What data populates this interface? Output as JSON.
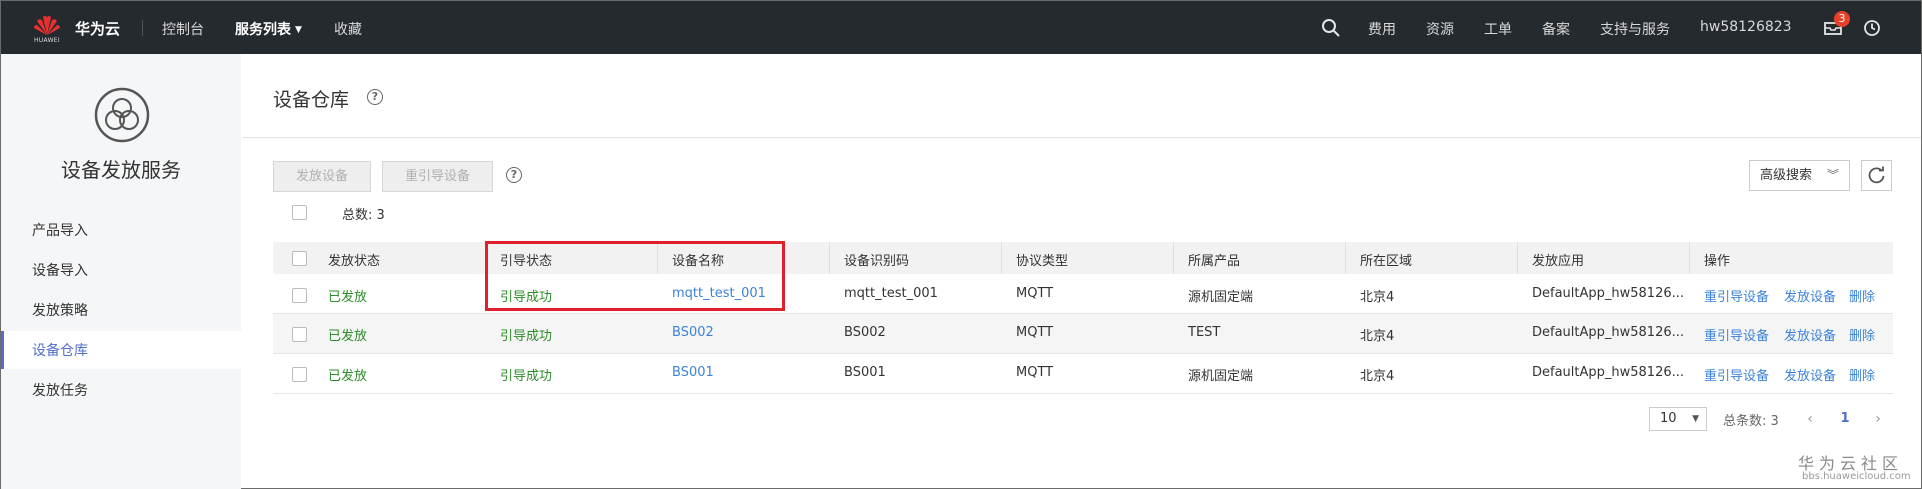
{
  "topbar": {
    "logo_text": "HUAWEI",
    "brand": "华为云",
    "nav": [
      "控制台",
      "服务列表",
      "收藏"
    ],
    "right_items": [
      "费用",
      "资源",
      "工单",
      "备案",
      "支持与服务"
    ],
    "username": "hw58126823",
    "notifications_count": "3"
  },
  "sidebar": {
    "service_title": "设备发放服务",
    "items": [
      "产品导入",
      "设备导入",
      "发放策略",
      "设备仓库",
      "发放任务"
    ],
    "active": "设备仓库"
  },
  "main": {
    "title": "设备仓库",
    "buttons": {
      "provision": "发放设备",
      "reguide": "重引导设备"
    },
    "total_label": "总数: 3",
    "advanced_search": "高级搜索"
  },
  "table": {
    "headers": [
      "发放状态",
      "引导状态",
      "设备名称",
      "设备识别码",
      "协议类型",
      "所属产品",
      "所在区域",
      "发放应用",
      "操作"
    ],
    "rows": [
      {
        "provision_status": "已发放",
        "guide_status": "引导成功",
        "device_name": "mqtt_test_001",
        "device_id": "mqtt_test_001",
        "protocol": "MQTT",
        "product": "源机固定端",
        "region": "北京4",
        "app": "DefaultApp_hw58126...",
        "actions": [
          "重引导设备",
          "发放设备",
          "删除"
        ]
      },
      {
        "provision_status": "已发放",
        "guide_status": "引导成功",
        "device_name": "BS002",
        "device_id": "BS002",
        "protocol": "MQTT",
        "product": "TEST",
        "region": "北京4",
        "app": "DefaultApp_hw58126...",
        "actions": [
          "重引导设备",
          "发放设备",
          "删除"
        ]
      },
      {
        "provision_status": "已发放",
        "guide_status": "引导成功",
        "device_name": "BS001",
        "device_id": "BS001",
        "protocol": "MQTT",
        "product": "源机固定端",
        "region": "北京4",
        "app": "DefaultApp_hw58126...",
        "actions": [
          "重引导设备",
          "发放设备",
          "删除"
        ]
      }
    ]
  },
  "pagination": {
    "page_size": "10",
    "total_label": "总条数: 3",
    "current_page": "1"
  },
  "watermark": {
    "line1": "华为云社区",
    "line2": "bbs.huaweicloud.com"
  },
  "colors": {
    "topbar_bg": "#252a2f",
    "accent": "#526ecc",
    "success": "#2c8c27",
    "link": "#3c83d8",
    "highlight_box": "#e0202a"
  }
}
